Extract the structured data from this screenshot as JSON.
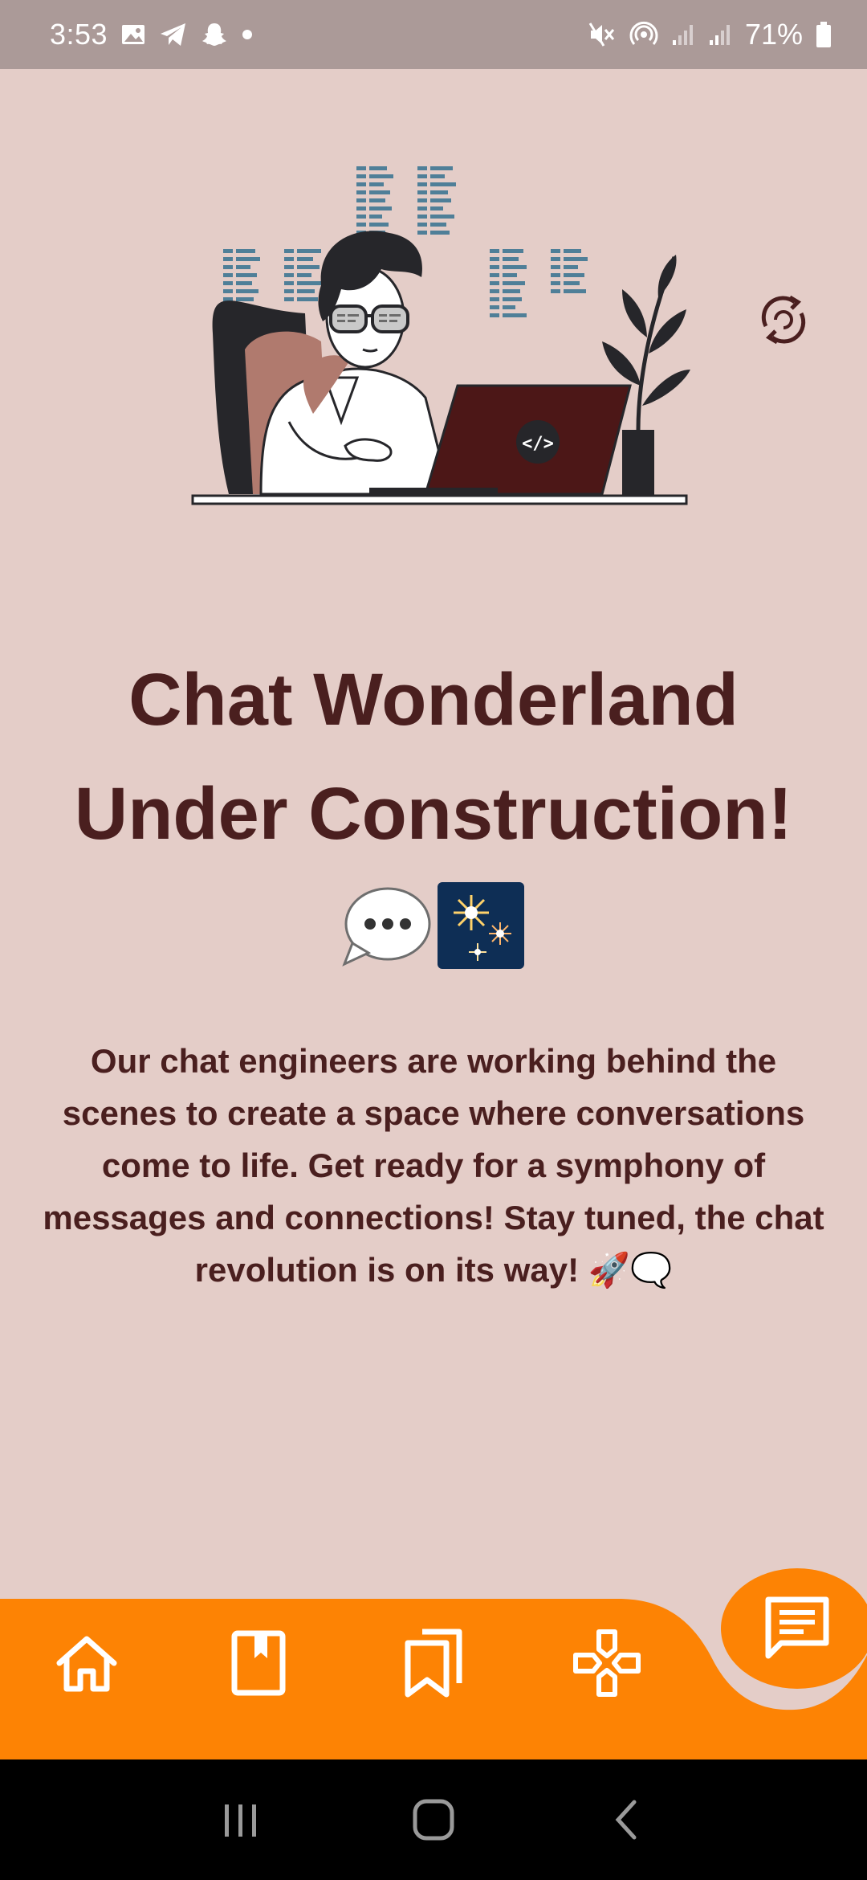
{
  "status_bar": {
    "time": "3:53",
    "battery": "71%"
  },
  "headline": {
    "line1": "Chat Wonderland",
    "line2": "Under Construction!"
  },
  "emojis": [
    "💬",
    "🎆"
  ],
  "description": "Our chat engineers are working behind the scenes to create a space where conversations come to life. Get ready for a symphony of messages and connections! Stay tuned, the chat revolution is on its way! 🚀🗨️",
  "bottom_nav": {
    "items": [
      {
        "icon": "home-icon"
      },
      {
        "icon": "book-icon"
      },
      {
        "icon": "bookmarks-icon"
      },
      {
        "icon": "gamepad-icon"
      }
    ],
    "fab_icon": "chat-icon"
  },
  "colors": {
    "background": "#e4cdc8",
    "status_bar": "#ab9a98",
    "accent": "#fd8304",
    "text": "#4a1f1f"
  }
}
